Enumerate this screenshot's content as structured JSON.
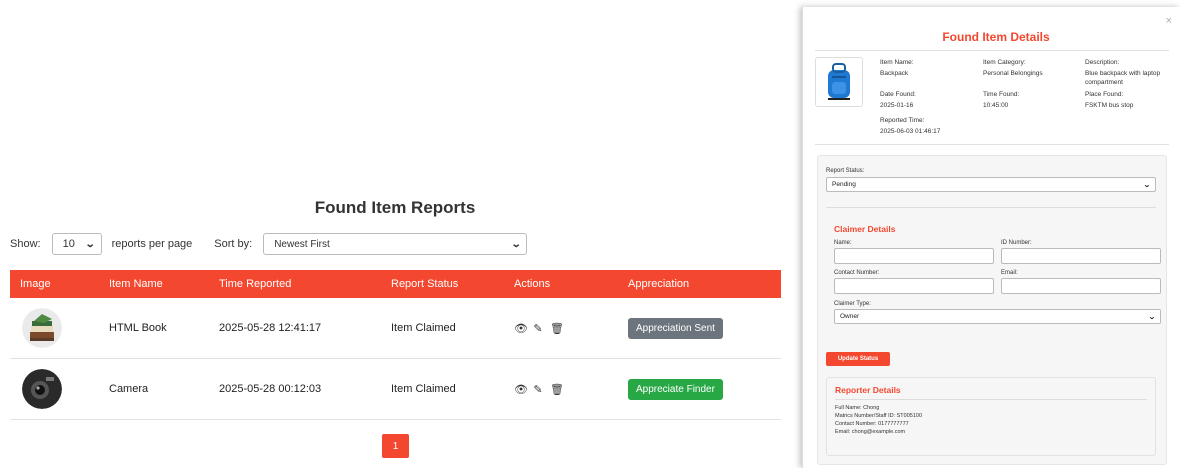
{
  "main": {
    "title": "Found Item Reports",
    "show_label": "Show:",
    "per_page_value": "10",
    "per_page_suffix": "reports per page",
    "sort_label": "Sort by:",
    "sort_value": "Newest First",
    "columns": [
      "Image",
      "Item Name",
      "Time Reported",
      "Report Status",
      "Actions",
      "Appreciation"
    ],
    "rows": [
      {
        "item_name": "HTML Book",
        "time_reported": "2025-05-28 12:41:17",
        "status": "Item Claimed",
        "appreciation": "Appreciation Sent",
        "appreciation_color": "#6c757d",
        "image_icon": "books-thumbnail"
      },
      {
        "item_name": "Camera",
        "time_reported": "2025-05-28 00:12:03",
        "status": "Item Claimed",
        "appreciation": "Appreciate Finder",
        "appreciation_color": "#28a745",
        "image_icon": "camera-thumbnail"
      }
    ],
    "page_number": "1"
  },
  "modal": {
    "title": "Found Item Details",
    "close_glyph": "×",
    "image_icon": "backpack-image",
    "details": {
      "item_name_label": "Item Name:",
      "item_name": "Backpack",
      "category_label": "Item Category:",
      "category": "Personal Belongings",
      "description_label": "Description:",
      "description": "Blue backpack with laptop compartment",
      "date_found_label": "Date Found:",
      "date_found": "2025-01-16",
      "time_found_label": "Time Found:",
      "time_found": "10:45:00",
      "place_found_label": "Place Found:",
      "place_found": "FSKTM bus stop",
      "reported_time_label": "Reported Time:",
      "reported_time": "2025-06-03 01:46:17"
    },
    "report_status_label": "Report Status:",
    "report_status_value": "Pending",
    "claimer": {
      "title": "Claimer Details",
      "name_label": "Name:",
      "id_label": "ID Number:",
      "contact_label": "Contact Number:",
      "email_label": "Email:",
      "type_label": "Claimer Type:",
      "type_value": "Owner"
    },
    "update_button": "Update Status",
    "reporter": {
      "title": "Reporter Details",
      "full_name": "Full Name: Chong",
      "matrics": "Matrics Number/Staff ID: ST005100",
      "contact": "Contact Number: 0177777777",
      "email": "Email: chong@example.com"
    }
  },
  "colors": {
    "accent": "#f4472f",
    "grey_button": "#6c757d",
    "green_button": "#28a745"
  }
}
